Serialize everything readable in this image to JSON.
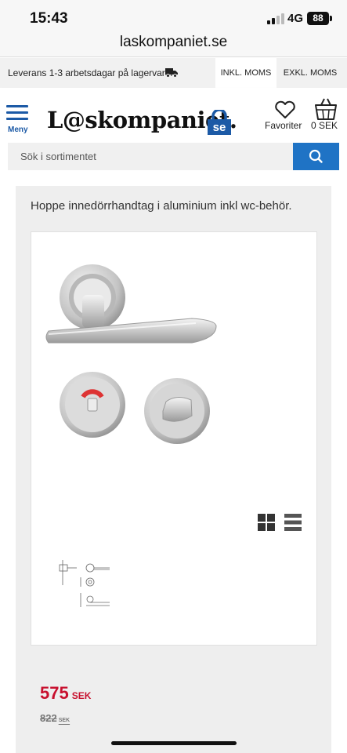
{
  "status": {
    "time": "15:43",
    "network": "4G",
    "battery": "88"
  },
  "browser": {
    "url": "laskompaniet.se"
  },
  "infobar": {
    "delivery": "Leverans 1-3 arbetsdagar på lagervaror",
    "incl_vat": "INKL. MOMS",
    "excl_vat": "EXKL. MOMS"
  },
  "header": {
    "menu_label": "Meny",
    "logo_text": "L@skompaniet.",
    "logo_suffix": "se",
    "favorites_label": "Favoriter",
    "cart_label": "0 SEK"
  },
  "search": {
    "placeholder": "Sök i sortimentet"
  },
  "product": {
    "title": "Hoppe innedörrhandtag i aluminium inkl wc-behör.",
    "price": "575",
    "currency": "SEK",
    "old_price": "822",
    "old_currency": "SEK"
  },
  "colors": {
    "brand_blue": "#1c5aa6",
    "search_button": "#1f73c5",
    "price_red": "#c8102e"
  },
  "icons": [
    "menu-icon",
    "heart-icon",
    "basket-icon",
    "search-icon",
    "truck-icon",
    "grid-view-icon",
    "list-view-icon"
  ]
}
